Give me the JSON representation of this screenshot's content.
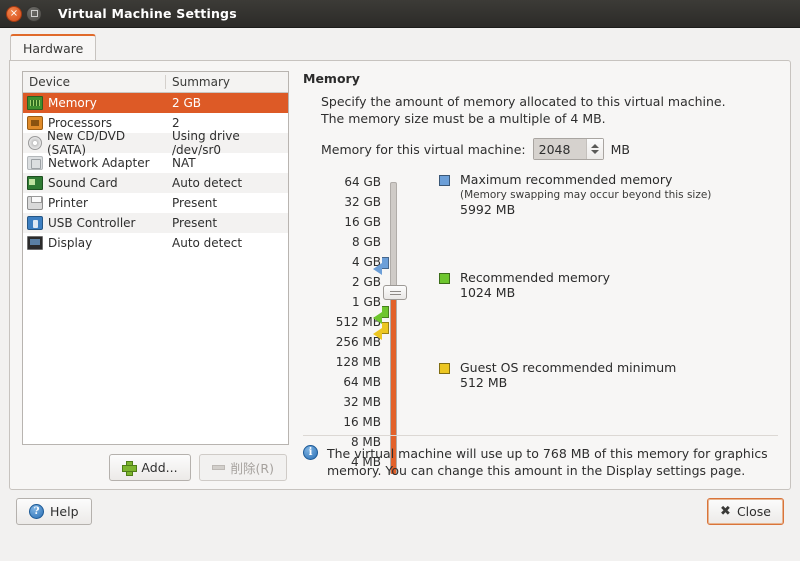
{
  "window": {
    "title": "Virtual Machine Settings",
    "close_icon": "window-close-icon",
    "maximize_icon": "window-maximize-icon"
  },
  "tabs": [
    {
      "label": "Hardware",
      "active": true
    }
  ],
  "device_list": {
    "columns": [
      "Device",
      "Summary"
    ],
    "rows": [
      {
        "device": "Memory",
        "summary": "2 GB",
        "icon": "memory-icon",
        "selected": true
      },
      {
        "device": "Processors",
        "summary": "2",
        "icon": "cpu-icon",
        "selected": false
      },
      {
        "device": "New CD/DVD (SATA)",
        "summary": "Using drive /dev/sr0",
        "icon": "cd-dvd-icon",
        "selected": false
      },
      {
        "device": "Network Adapter",
        "summary": "NAT",
        "icon": "network-adapter-icon",
        "selected": false
      },
      {
        "device": "Sound Card",
        "summary": "Auto detect",
        "icon": "sound-card-icon",
        "selected": false
      },
      {
        "device": "Printer",
        "summary": "Present",
        "icon": "printer-icon",
        "selected": false
      },
      {
        "device": "USB Controller",
        "summary": "Present",
        "icon": "usb-controller-icon",
        "selected": false
      },
      {
        "device": "Display",
        "summary": "Auto detect",
        "icon": "display-icon",
        "selected": false
      }
    ],
    "add_button": "Add...",
    "remove_button": "削除(R)",
    "remove_enabled": false
  },
  "memory_panel": {
    "title": "Memory",
    "description": "Specify the amount of memory allocated to this virtual machine. The memory size must be a multiple of 4 MB.",
    "field_label": "Memory for this virtual machine:",
    "value": "2048",
    "unit": "MB",
    "ticks": [
      "64 GB",
      "32 GB",
      "16 GB",
      "8 GB",
      "4 GB",
      "2 GB",
      "1 GB",
      "512 MB",
      "256 MB",
      "128 MB",
      "64 MB",
      "32 MB",
      "16 MB",
      "8 MB",
      "4 MB"
    ],
    "slider_position_label": "2 GB",
    "legend": [
      {
        "title": "Maximum recommended memory",
        "subtitle": "(Memory swapping may occur beyond this size)",
        "value": "5992 MB",
        "color": "#6c9fd8",
        "marker_color": "#6c9fd8"
      },
      {
        "title": "Recommended memory",
        "subtitle": "",
        "value": "1024 MB",
        "color": "#6ec62e",
        "marker_color": "#6ec62e"
      },
      {
        "title": "Guest OS recommended minimum",
        "subtitle": "",
        "value": "512 MB",
        "color": "#ecc621",
        "marker_color": "#ecc621"
      }
    ],
    "info_note": "The virtual machine will use up to 768 MB of this memory for graphics memory. You can change this amount in the Display settings page.",
    "info_icon": "info-icon"
  },
  "footer": {
    "help_label": "Help",
    "help_icon": "help-icon",
    "close_label": "Close",
    "close_icon": "close-x-icon"
  },
  "colors": {
    "accent_orange": "#dd5a26",
    "slider_fill": "#e2612a",
    "title_bar": "#2c2b28"
  }
}
